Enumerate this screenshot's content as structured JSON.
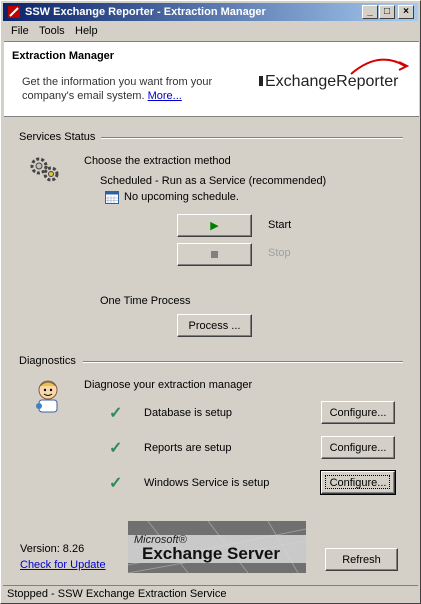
{
  "window": {
    "title": "SSW Exchange Reporter - Extraction Manager",
    "minimize_glyph": "_",
    "maximize_glyph": "□",
    "close_glyph": "×"
  },
  "menu": {
    "file": "File",
    "tools": "Tools",
    "help": "Help"
  },
  "header": {
    "title": "Extraction Manager",
    "description": "Get the information you want from your company's email system.",
    "more_link": "More...",
    "logo_text": "ExchangeReporter"
  },
  "services": {
    "section_label": "Services Status",
    "choose_method": "Choose the extraction method",
    "scheduled_label": "Scheduled - Run as a Service (recommended)",
    "schedule_status": "No upcoming schedule.",
    "start_label": "Start",
    "stop_label": "Stop",
    "one_time_label": "One Time Process",
    "process_button": "Process ..."
  },
  "diagnostics": {
    "section_label": "Diagnostics",
    "intro": "Diagnose your extraction manager",
    "items": [
      {
        "label": "Database is setup",
        "button": "Configure..."
      },
      {
        "label": "Reports are setup",
        "button": "Configure..."
      },
      {
        "label": "Windows Service is setup",
        "button": "Configure..."
      }
    ]
  },
  "footer": {
    "version": "Version: 8.26",
    "check_update": "Check for Update",
    "banner_small": "Microsoft®",
    "banner_large": "Exchange Server",
    "refresh_button": "Refresh"
  },
  "status": {
    "text": "Stopped - SSW Exchange Extraction Service"
  },
  "icons": {
    "app": "app-icon",
    "gears": "gears-icon",
    "calendar": "calendar-icon",
    "play": "play-icon",
    "stop": "stop-icon",
    "doctor": "doctor-icon",
    "check": "check-icon"
  },
  "colors": {
    "title_start": "#0a246a",
    "title_end": "#a6caf0",
    "link": "#0000cc",
    "check": "#2e8b57",
    "play": "#008000"
  }
}
